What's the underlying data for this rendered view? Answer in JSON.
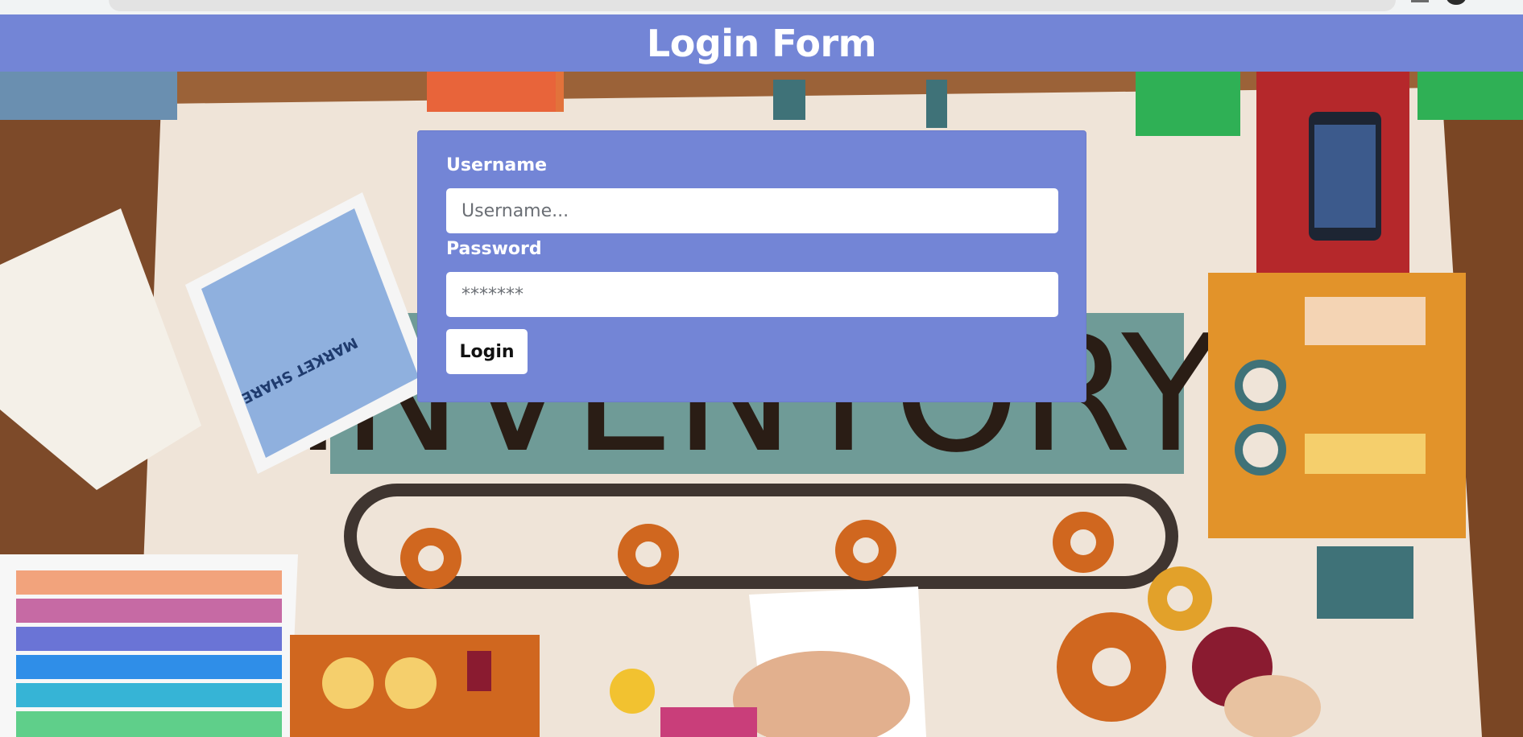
{
  "header": {
    "title": "Login Form"
  },
  "form": {
    "username_label": "Username",
    "username_placeholder": "Username...",
    "password_label": "Password",
    "password_placeholder": "*******",
    "login_button": "Login"
  },
  "background": {
    "poster_word": "INVENTORY",
    "tablet_text": "MARKET SHARE"
  },
  "colors": {
    "accent": "#7385d6",
    "button_bg": "#ffffff"
  }
}
